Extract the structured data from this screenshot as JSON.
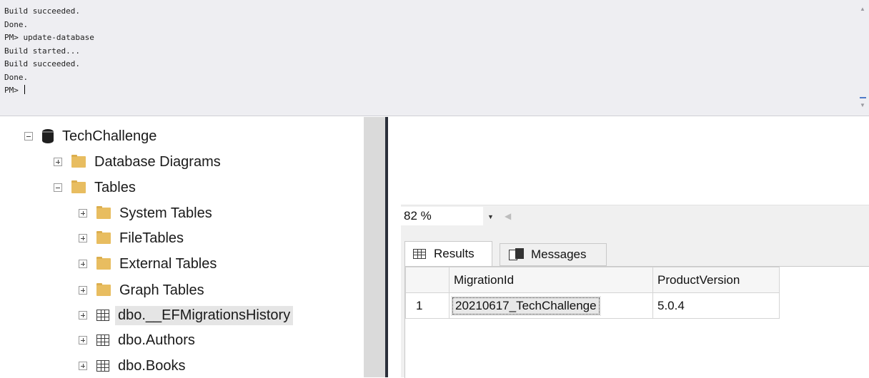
{
  "console": {
    "lines": [
      "Build succeeded.",
      "Done.",
      "PM> update-database",
      "Build started...",
      "Build succeeded.",
      "Done."
    ],
    "prompt": "PM> "
  },
  "explorer": {
    "database": "TechChallenge",
    "items": [
      {
        "label": "Database Diagrams",
        "icon": "folder-icon",
        "expander": "expand-icon"
      },
      {
        "label": "Tables",
        "icon": "folder-icon",
        "expander": "collapse-icon"
      },
      {
        "label": "System Tables",
        "icon": "folder-icon",
        "expander": "expand-icon"
      },
      {
        "label": "FileTables",
        "icon": "folder-icon",
        "expander": "expand-icon"
      },
      {
        "label": "External Tables",
        "icon": "folder-icon",
        "expander": "expand-icon"
      },
      {
        "label": "Graph Tables",
        "icon": "folder-icon",
        "expander": "expand-icon"
      },
      {
        "label": "dbo.__EFMigrationsHistory",
        "icon": "table-icon",
        "expander": "expand-icon",
        "selected": true
      },
      {
        "label": "dbo.Authors",
        "icon": "table-icon",
        "expander": "expand-icon"
      },
      {
        "label": "dbo.Books",
        "icon": "table-icon",
        "expander": "expand-icon"
      }
    ]
  },
  "zoom": {
    "value": "82 %"
  },
  "tabs": {
    "results": "Results",
    "messages": "Messages"
  },
  "grid": {
    "columns": [
      "MigrationId",
      "ProductVersion"
    ],
    "rows": [
      {
        "num": "1",
        "cells": [
          "20210617_TechChallenge",
          "5.0.4"
        ]
      }
    ]
  },
  "colors": {
    "folder": "#e8bd60",
    "console_bg": "#eeeef2",
    "divider": "#2b2f3a",
    "accent": "#4f7cc9"
  }
}
